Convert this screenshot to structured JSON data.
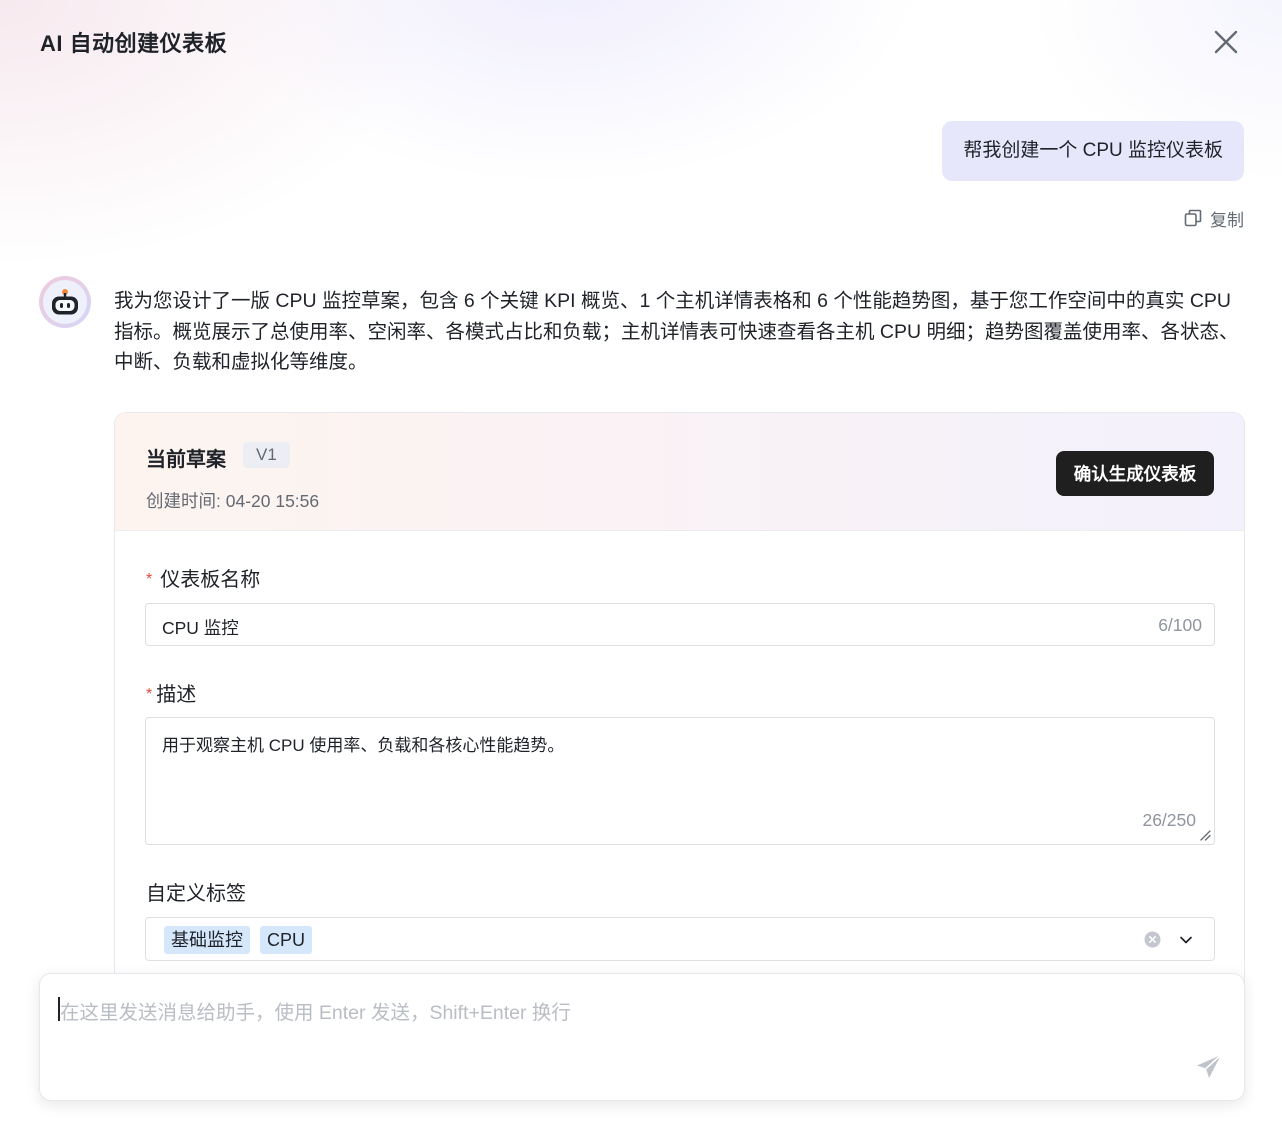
{
  "header": {
    "title": "AI 自动创建仪表板"
  },
  "user_message": {
    "text": "帮我创建一个 CPU 监控仪表板",
    "copy_label": "复制"
  },
  "ai_message": {
    "text": "我为您设计了一版 CPU 监控草案，包含 6 个关键 KPI 概览、1 个主机详情表格和 6 个性能趋势图，基于您工作空间中的真实 CPU 指标。概览展示了总使用率、空闲率、各模式占比和负载；主机详情表可快速查看各主机 CPU 明细；趋势图覆盖使用率、各状态、中断、负载和虚拟化等维度。"
  },
  "draft": {
    "title": "当前草案",
    "version": "V1",
    "created_at": "创建时间: 04-20 15:56",
    "confirm_label": "确认生成仪表板",
    "name_field": {
      "label": "仪表板名称",
      "value": "CPU 监控",
      "counter": "6/100"
    },
    "description_field": {
      "label": "描述",
      "value": "用于观察主机 CPU 使用率、负载和各核心性能趋势。",
      "counter": "26/250"
    },
    "tags_field": {
      "label": "自定义标签",
      "tags": [
        "基础监控",
        "CPU"
      ]
    }
  },
  "composer": {
    "placeholder": "在这里发送消息给助手，使用 Enter 发送，Shift+Enter 换行"
  },
  "colors": {
    "accent_dark": "#1f1f1f",
    "user_bubble": "#e6e7fb",
    "tag_bg": "#d5e8fb",
    "required_mark": "#e5483b"
  }
}
